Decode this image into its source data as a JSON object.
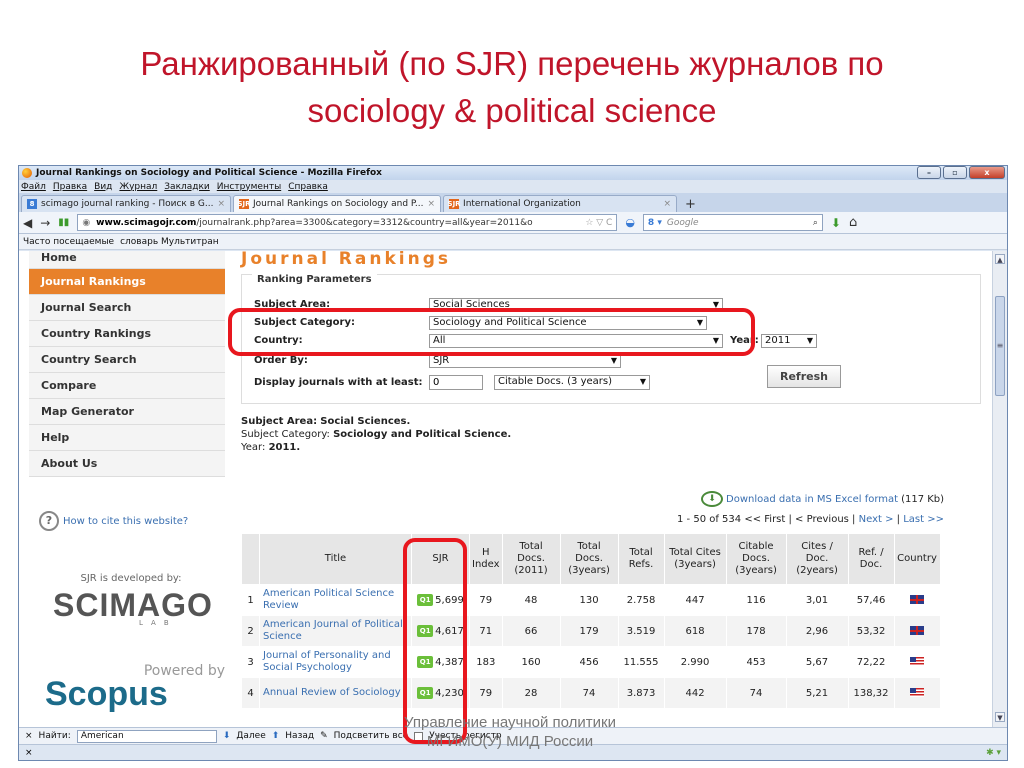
{
  "slide": {
    "title_line1": "Ранжированный (по SJR) перечень журналов по",
    "title_line2": "sociology & political science",
    "footer_line1": "Управление научной политики",
    "footer_line2": "МГИМО(У) МИД России"
  },
  "window": {
    "title": "Journal Rankings on Sociology and Political Science - Mozilla Firefox",
    "minimize": "–",
    "maximize": "▫",
    "close": "x"
  },
  "menu": [
    "Файл",
    "Правка",
    "Вид",
    "Журнал",
    "Закладки",
    "Инструменты",
    "Справка"
  ],
  "tabs": [
    {
      "fav": "8",
      "label": "scimago journal ranking - Поиск в G...",
      "close": "×",
      "active": false
    },
    {
      "fav": "SJR",
      "label": "Journal Rankings on Sociology and P...",
      "close": "×",
      "active": true
    },
    {
      "fav": "SJR",
      "label": "International Organization",
      "close": "×",
      "active": false
    }
  ],
  "newtab": "+",
  "nav": {
    "back": "◆",
    "forward": "→",
    "url_domain": "www.scimagojr.com",
    "url_path": "/journalrank.php?area=3300&category=3312&country=all&year=2011&o",
    "url_icons": "☆ ▽ C",
    "search_engine": "8 ▾",
    "search_placeholder": "Google",
    "search_icon": "⌕",
    "download_icon": "⬇",
    "home_icon": "⌂"
  },
  "bookmarks": [
    "Часто посещаемые",
    "словарь Мультитран"
  ],
  "sidebar": {
    "items": [
      "Home",
      "Journal Rankings",
      "Journal Search",
      "Country Rankings",
      "Country Search",
      "Compare",
      "Map Generator",
      "Help",
      "About Us"
    ],
    "cite_link": "How to cite this website?",
    "developed_by": "SJR is developed by:",
    "scimago": "SCIMAGO",
    "scimago_lab": "LAB",
    "powered_by": "Powered by",
    "scopus": "Scopus"
  },
  "rankings": {
    "heading": "Journal Rankings",
    "params_legend": "Ranking Parameters",
    "subject_area_label": "Subject Area:",
    "subject_area_value": "Social Sciences",
    "subject_category_label": "Subject Category:",
    "subject_category_value": "Sociology and Political Science",
    "country_label": "Country:",
    "country_value": "All",
    "year_label": "Year:",
    "year_value": "2011",
    "order_label": "Order By:",
    "order_value": "SJR",
    "display_label": "Display journals with at least:",
    "display_value": "0",
    "citable_value": "Citable Docs. (3 years)",
    "refresh": "Refresh",
    "info_area_label": "Subject Area:",
    "info_area": "Social Sciences.",
    "info_cat_label": "Subject Category:",
    "info_cat": "Sociology and Political Science.",
    "info_year_label": "Year:",
    "info_year": "2011.",
    "download_text": "Download data in MS Excel format",
    "download_size": "(117 Kb)",
    "pager_count": "1 - 50 of 534",
    "pager_first": "<< First",
    "pager_prev": "< Previous",
    "pager_next": "Next >",
    "pager_last": "Last >>"
  },
  "table": {
    "headers": [
      "",
      "Title",
      "SJR",
      "H Index",
      "Total Docs. (2011)",
      "Total Docs. (3years)",
      "Total Refs.",
      "Total Cites (3years)",
      "Citable Docs. (3years)",
      "Cites / Doc. (2years)",
      "Ref. / Doc.",
      "Country"
    ],
    "rows": [
      {
        "rank": "1",
        "title": "American Political Science Review",
        "quartile": "Q1",
        "sjr": "5,699",
        "h": "79",
        "docs2011": "48",
        "docs3": "130",
        "refs": "2.758",
        "cites3": "447",
        "citable3": "116",
        "cpd": "3,01",
        "rpd": "57,46",
        "country": "uk"
      },
      {
        "rank": "2",
        "title": "American Journal of Political Science",
        "quartile": "Q1",
        "sjr": "4,617",
        "h": "71",
        "docs2011": "66",
        "docs3": "179",
        "refs": "3.519",
        "cites3": "618",
        "citable3": "178",
        "cpd": "2,96",
        "rpd": "53,32",
        "country": "uk"
      },
      {
        "rank": "3",
        "title": "Journal of Personality and Social Psychology",
        "quartile": "Q1",
        "sjr": "4,387",
        "h": "183",
        "docs2011": "160",
        "docs3": "456",
        "refs": "11.555",
        "cites3": "2.990",
        "citable3": "453",
        "cpd": "5,67",
        "rpd": "72,22",
        "country": "us"
      },
      {
        "rank": "4",
        "title": "Annual Review of Sociology",
        "quartile": "Q1",
        "sjr": "4,230",
        "h": "79",
        "docs2011": "28",
        "docs3": "74",
        "refs": "3.873",
        "cites3": "442",
        "citable3": "74",
        "cpd": "5,21",
        "rpd": "138,32",
        "country": "us"
      }
    ]
  },
  "findbar": {
    "close": "×",
    "label": "Найти:",
    "value": "American",
    "next": "Далее",
    "prev": "Назад",
    "highlight": "Подсветить все",
    "matchcase": "Учесть регистр"
  },
  "status": {
    "close": "×"
  }
}
